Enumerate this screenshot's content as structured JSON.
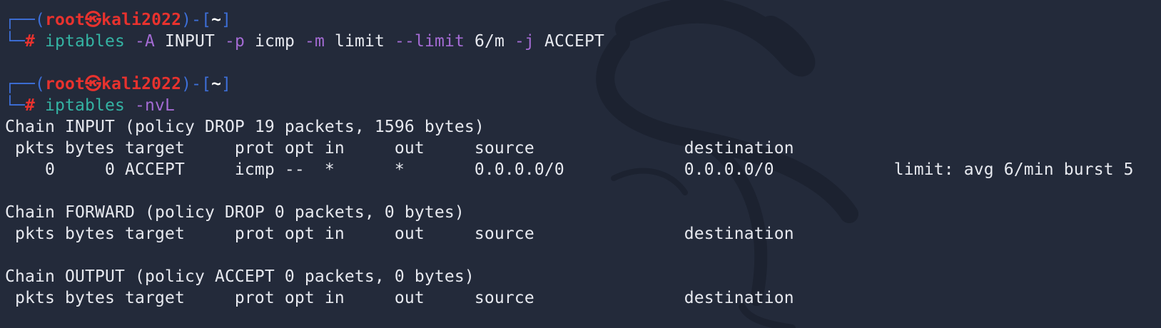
{
  "prompt": {
    "user": "root",
    "separator_glyph": "㉿",
    "host": "kali2022",
    "cwd": "~",
    "symbol": "#"
  },
  "command1": {
    "program": "iptables",
    "tokens": [
      {
        "text": "-A",
        "kind": "opt"
      },
      {
        "text": "INPUT",
        "kind": "arg"
      },
      {
        "text": "-p",
        "kind": "opt"
      },
      {
        "text": "icmp",
        "kind": "arg"
      },
      {
        "text": "-m",
        "kind": "opt"
      },
      {
        "text": "limit",
        "kind": "arg"
      },
      {
        "text": "--limit",
        "kind": "opt"
      },
      {
        "text": "6/m",
        "kind": "arg"
      },
      {
        "text": "-j",
        "kind": "opt"
      },
      {
        "text": "ACCEPT",
        "kind": "arg"
      }
    ]
  },
  "command2": {
    "program": "iptables",
    "tokens": [
      {
        "text": "-nvL",
        "kind": "opt"
      }
    ]
  },
  "output": {
    "chains": [
      {
        "header": "Chain INPUT (policy DROP 19 packets, 1596 bytes)",
        "columns": " pkts bytes target     prot opt in     out     source               destination",
        "rows": [
          "    0     0 ACCEPT     icmp --  *      *       0.0.0.0/0            0.0.0.0/0            limit: avg 6/min burst 5"
        ]
      },
      {
        "header": "Chain FORWARD (policy DROP 0 packets, 0 bytes)",
        "columns": " pkts bytes target     prot opt in     out     source               destination",
        "rows": []
      },
      {
        "header": "Chain OUTPUT (policy ACCEPT 0 packets, 0 bytes)",
        "columns": " pkts bytes target     prot opt in     out     source               destination",
        "rows": []
      }
    ]
  },
  "colors": {
    "background": "#232a3a",
    "prompt_box": "#3d6fd8",
    "prompt_user": "#e8322e",
    "command": "#34b3a3",
    "option": "#a46bd4",
    "text": "#e7e9ef"
  }
}
